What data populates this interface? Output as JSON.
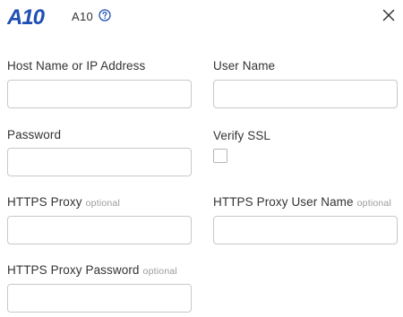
{
  "header": {
    "logo_text": "A10",
    "app_name": "A10",
    "icons": {
      "help": "help-circle-icon",
      "close": "close-icon"
    },
    "brand_color": "#1f4fb3"
  },
  "form": {
    "host": {
      "label": "Host Name or IP Address",
      "value": ""
    },
    "user": {
      "label": "User Name",
      "value": ""
    },
    "password": {
      "label": "Password",
      "value": ""
    },
    "verify_ssl": {
      "label": "Verify SSL",
      "checked": false
    },
    "https_proxy": {
      "label": "HTTPS Proxy",
      "optional": "optional",
      "value": ""
    },
    "https_proxy_user": {
      "label": "HTTPS Proxy User Name",
      "optional": "optional",
      "value": ""
    },
    "https_proxy_password": {
      "label": "HTTPS Proxy Password",
      "optional": "optional",
      "value": ""
    }
  }
}
